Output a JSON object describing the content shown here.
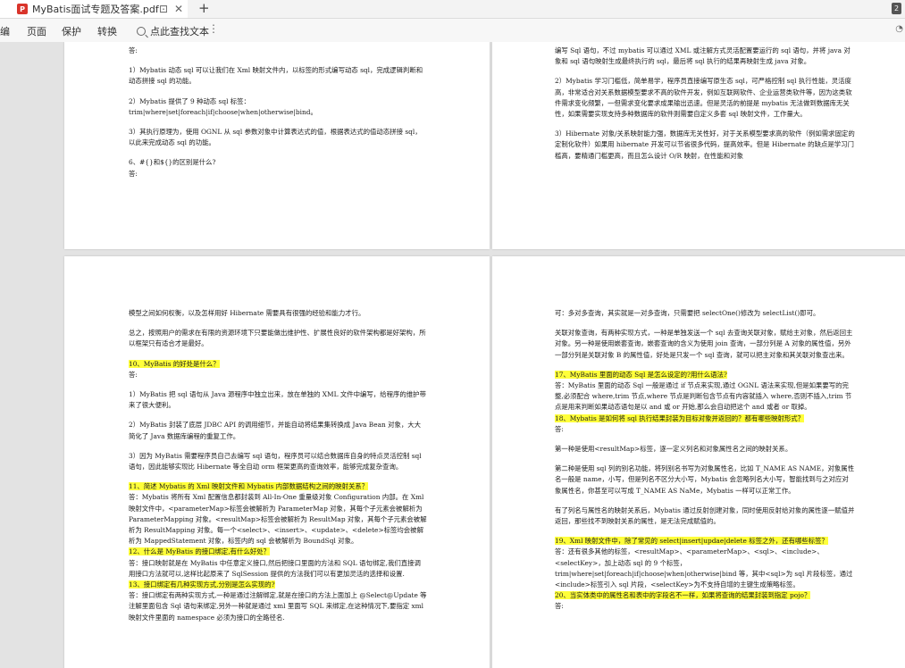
{
  "tab": {
    "title": "MyBatis面试专题及答案.pdf",
    "icon": "pdf-icon",
    "pin": "⊡",
    "close": "✕",
    "new": "+",
    "badge": "2"
  },
  "toolbar": {
    "edit": "编",
    "page": "页面",
    "protect": "保护",
    "convert": "转换",
    "search_placeholder": "点此查找文本",
    "more": "⋮"
  },
  "page1": {
    "answer_label": "答:",
    "p1": "1）Mybatis 动态 sql 可以让我们在 Xml 映射文件内，以标签的形式编写动态 sql，完成逻辑判断和动态拼接 sql 的功能。",
    "p2a": "2）Mybatis 提供了 9 种动态 sql 标签：",
    "p2b": "trim|where|set|foreach|if|choose|when|otherwise|bind。",
    "p3": "3）其执行原理为，使用 OGNL 从 sql 参数对象中计算表达式的值，根据表达式的值动态拼接 sql，以此来完成动态 sql 的功能。",
    "q6": "6、#{}和${}的区别是什么?",
    "q6_answer": "答:"
  },
  "page2": {
    "p1": "编写 Sql 语句，不过 mybatis 可以通过 XML 或注解方式灵活配置要运行的 sql 语句，并将 java 对象和 sql 语句映射生成最终执行的 sql，最后将 sql 执行的结果再映射生成 java 对象。",
    "p2": "2）Mybatis 学习门槛低，简单易学，程序员直接编写原生态 sql，可严格控制 sql 执行性能，灵活度高，非常适合对关系数据模型要求不高的软件开发，例如互联网软件、企业运营类软件等，因为这类软件需求变化频繁，一但需求变化要求成果输出迅速。但是灵活的前提是 mybatis 无法做到数据库无关性，如果需要实现支持多种数据库的软件则需要自定义多套 sql 映射文件，工作量大。",
    "p3": "3）Hibernate 对象/关系映射能力强，数据库无关性好，对于关系模型要求高的软件（例如需求固定的定制化软件）如果用 hibernate 开发可以节省很多代码，提高效率。但是 Hibernate 的缺点是学习门槛高，要精通门槛更高，而且怎么设计 O/R 映射，在性能和对象"
  },
  "page3": {
    "p1": "模型之间如何权衡，以及怎样用好 Hibernate 需要具有很强的经验和能力才行。",
    "p2": "总之，按照用户的需求在有限的资源环境下只要能做出维护性、扩展性良好的软件架构都是好架构，所以框架只有适合才是最好。",
    "q10": "10、MyBatis 的好处是什么？",
    "a10": "答:",
    "p3": "1）MyBatis 把 sql 语句从 Java 源程序中独立出来，放在单独的 XML 文件中编写，给程序的维护带来了很大便利。",
    "p4": "2）MyBatis 封装了底层 JDBC API 的调用细节，并能自动将结果集转换成 Java Bean 对象，大大简化了 Java 数据库编程的重复工作。",
    "p5": "3）因为 MyBatis 需要程序员自己去编写 sql 语句，程序员可以结合数据库自身的特点灵活控制 sql 语句，因此能够实现比 Hibernate 等全自动 orm 框架更高的查询效率，能够完成复杂查询。",
    "q11": "11、简述 Mybatis 的 Xml 映射文件和 Mybatis 内部数据结构之间的映射关系？",
    "a11": "答：Mybatis 将所有 Xml 配置信息都封装到 All-In-One 重量级对象 Configuration 内部。在 Xml 映射文件中，<parameterMap>标签会被解析为 ParameterMap 对象，其每个子元素会被解析为 ParameterMapping 对象。<resultMap>标签会被解析为 ResultMap 对象，其每个子元素会被解析为 ResultMapping 对象。每一个<select>、<insert>、<update>、<delete>标签均会被解析为 MappedStatement 对象，标签内的 sql 会被解析为 BoundSql 对象。",
    "q12": "12、什么是 MyBatis 的接口绑定,有什么好处？",
    "a12": "答：接口映射就是在 MyBatis 中任意定义接口,然后把接口里面的方法和 SQL 语句绑定,我们直接调用接口方法就可以,这样比起原来了 SqlSession 提供的方法我们可以有更加灵活的选择和设置.",
    "q13": "13、接口绑定有几种实现方式,分别是怎么实现的?",
    "a13": "答：接口绑定有两种实现方式,一种是通过注解绑定,就是在接口的方法上面加上 @Select@Update 等注解里面包含 Sql 语句来绑定,另外一种就是通过 xml 里面写 SQL 来绑定,在这种情况下,要指定 xml 映射文件里面的 namespace 必须为接口的全路径名."
  },
  "page4": {
    "p1": "可：多对多查询，其实就是一对多查询，只需要把 selectOne()修改为 selectList()即可。",
    "p2": "关联对象查询，有两种实现方式，一种是单独发送一个 sql 去查询关联对象，赋给主对象，然后返回主对象。另一种是使用嵌套查询，嵌套查询的含义为使用 join 查询，一部分列是 A 对象的属性值，另外一部分列是关联对象 B 的属性值，好处是只发一个 sql 查询，就可以把主对象和其关联对象查出来。",
    "q17": "17、MyBatis 里面的动态 Sql 是怎么设定的?用什么语法?",
    "a17": "答：MyBatis 里面的动态 Sql 一般是通过 if 节点来实现,通过 OGNL 语法来实现,但是如果要写的完整,必须配合 where,trim 节点,where 节点是判断包含节点有内容就插入 where,否则不插入,trim 节点是用来判断如果动态语句是以 and 或 or 开始,那么会自动把这个 and 或者 or 取掉。",
    "q18": "18、Mybatis 是如何将 sql 执行结果封装为目标对象并返回的？都有哪些映射形式？",
    "a18": "答:",
    "p3": "第一种是使用<resultMap>标签，逐一定义列名和对象属性名之间的映射关系。",
    "p4": "第二种是使用 sql 列的别名功能，将列别名书写为对象属性名，比如 T_NAME AS NAME，对象属性名一般是 name，小写，但是列名不区分大小写，Mybatis 会忽略列名大小写，智能找到与之对应对象属性名，你甚至可以写成 T_NAME AS NaMe，Mybatis 一样可以正常工作。",
    "p5": "有了列名与属性名的映射关系后，Mybatis 通过反射创建对象，同时使用反射给对象的属性逐一赋值并返回，那些找不到映射关系的属性，是无法完成赋值的。",
    "q19": "19、Xml 映射文件中，除了常见的 select|insert|updae|delete 标签之外，还有哪些标签？",
    "a19": "答：还有很多其他的标签，<resultMap>、<parameterMap>、<sql>、<include>、<selectKey>，加上动态 sql 的 9 个标签，trim|where|set|foreach|if|choose|when|otherwise|bind 等，其中<sql>为 sql 片段标签，通过<include>标签引入 sql 片段，<selectKey>为不支持自增的主键生成策略标签。",
    "q20": "20、当实体类中的属性名和表中的字段名不一样，如果将查询的结果封装到指定 pojo？",
    "a20": "答:"
  }
}
